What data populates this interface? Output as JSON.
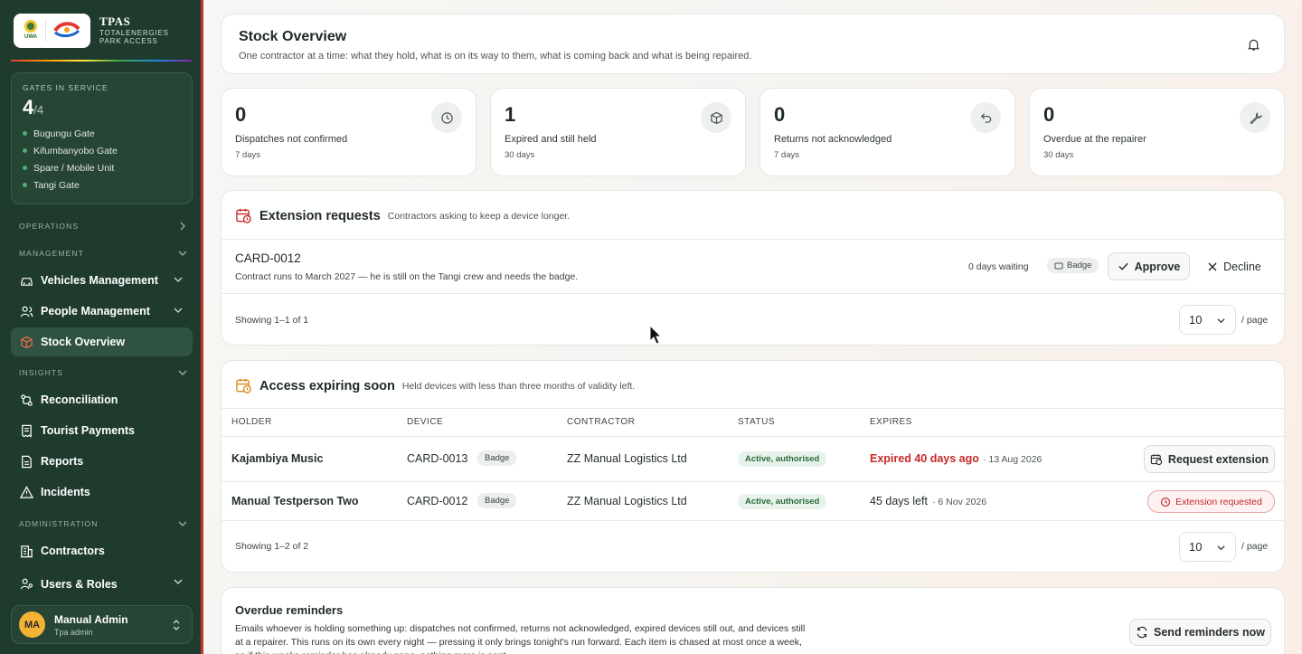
{
  "brand": {
    "name": "TPAS",
    "tagline1": "TOTALENERGIES",
    "tagline2": "PARK ACCESS",
    "logo_text": "UWA"
  },
  "gates": {
    "heading": "GATES IN SERVICE",
    "count": "4",
    "total": "/4",
    "items": [
      "Bugungu Gate",
      "Kifumbanyobo Gate",
      "Spare / Mobile Unit",
      "Tangi Gate"
    ]
  },
  "nav": {
    "operations": "OPERATIONS",
    "management": "MANAGEMENT",
    "vehicles": "Vehicles Management",
    "people": "People Management",
    "stock": "Stock Overview",
    "insights": "INSIGHTS",
    "reconciliation": "Reconciliation",
    "tourist": "Tourist Payments",
    "reports": "Reports",
    "incidents": "Incidents",
    "administration": "ADMINISTRATION",
    "contractors": "Contractors",
    "users": "Users & Roles"
  },
  "user": {
    "initials": "MA",
    "name": "Manual Admin",
    "role": "Tpa admin"
  },
  "header": {
    "title": "Stock Overview",
    "subtitle": "One contractor at a time: what they hold, what is on its way to them, what is coming back and what is being repaired."
  },
  "stats": [
    {
      "value": "0",
      "label": "Dispatches not confirmed",
      "period": "7 days",
      "icon": "clock-icon"
    },
    {
      "value": "1",
      "label": "Expired and still held",
      "period": "30 days",
      "icon": "package-icon"
    },
    {
      "value": "0",
      "label": "Returns not acknowledged",
      "period": "7 days",
      "icon": "return-icon"
    },
    {
      "value": "0",
      "label": "Overdue at the repairer",
      "period": "30 days",
      "icon": "wrench-icon"
    }
  ],
  "extensions": {
    "title": "Extension requests",
    "desc": "Contractors asking to keep a device longer.",
    "item": {
      "card": "CARD-0012",
      "note": "Contract runs to March 2027 — he is still on the Tangi crew and needs the badge.",
      "waiting": "0 days waiting",
      "type": "Badge",
      "approve": "Approve",
      "decline": "Decline"
    },
    "showing": "Showing 1–1 of 1",
    "page_size": "10",
    "per_page": "/ page"
  },
  "expiring": {
    "title": "Access expiring soon",
    "desc": "Held devices with less than three months of validity left.",
    "columns": [
      "HOLDER",
      "DEVICE",
      "CONTRACTOR",
      "STATUS",
      "EXPIRES"
    ],
    "rows": [
      {
        "holder": "Kajambiya Music",
        "device": "CARD-0013",
        "type": "Badge",
        "contractor": "ZZ Manual Logistics Ltd",
        "status": "Active, authorised",
        "expires": "Expired 40 days ago",
        "date": "· 13 Aug 2026",
        "action": "Request extension"
      },
      {
        "holder": "Manual Testperson Two",
        "device": "CARD-0012",
        "type": "Badge",
        "contractor": "ZZ Manual Logistics Ltd",
        "status": "Active, authorised",
        "expires": "45 days left",
        "date": "· 6 Nov 2026",
        "action": "Extension requested"
      }
    ],
    "showing": "Showing 1–2 of 2",
    "page_size": "10",
    "per_page": "/ page"
  },
  "reminders": {
    "title": "Overdue reminders",
    "text": "Emails whoever is holding something up: dispatches not confirmed, returns not acknowledged, expired devices still out, and devices still at a repairer. This runs on its own every night — pressing it only brings tonight's run forward. Each item is chased at most once a week, so if this weeks reminder has already gone, nothing more is sent.",
    "button": "Send reminders now"
  },
  "colors": {
    "sidebar": "#1f3b2e",
    "accent_red": "#c62828",
    "status_green": "#2b6a3f"
  }
}
